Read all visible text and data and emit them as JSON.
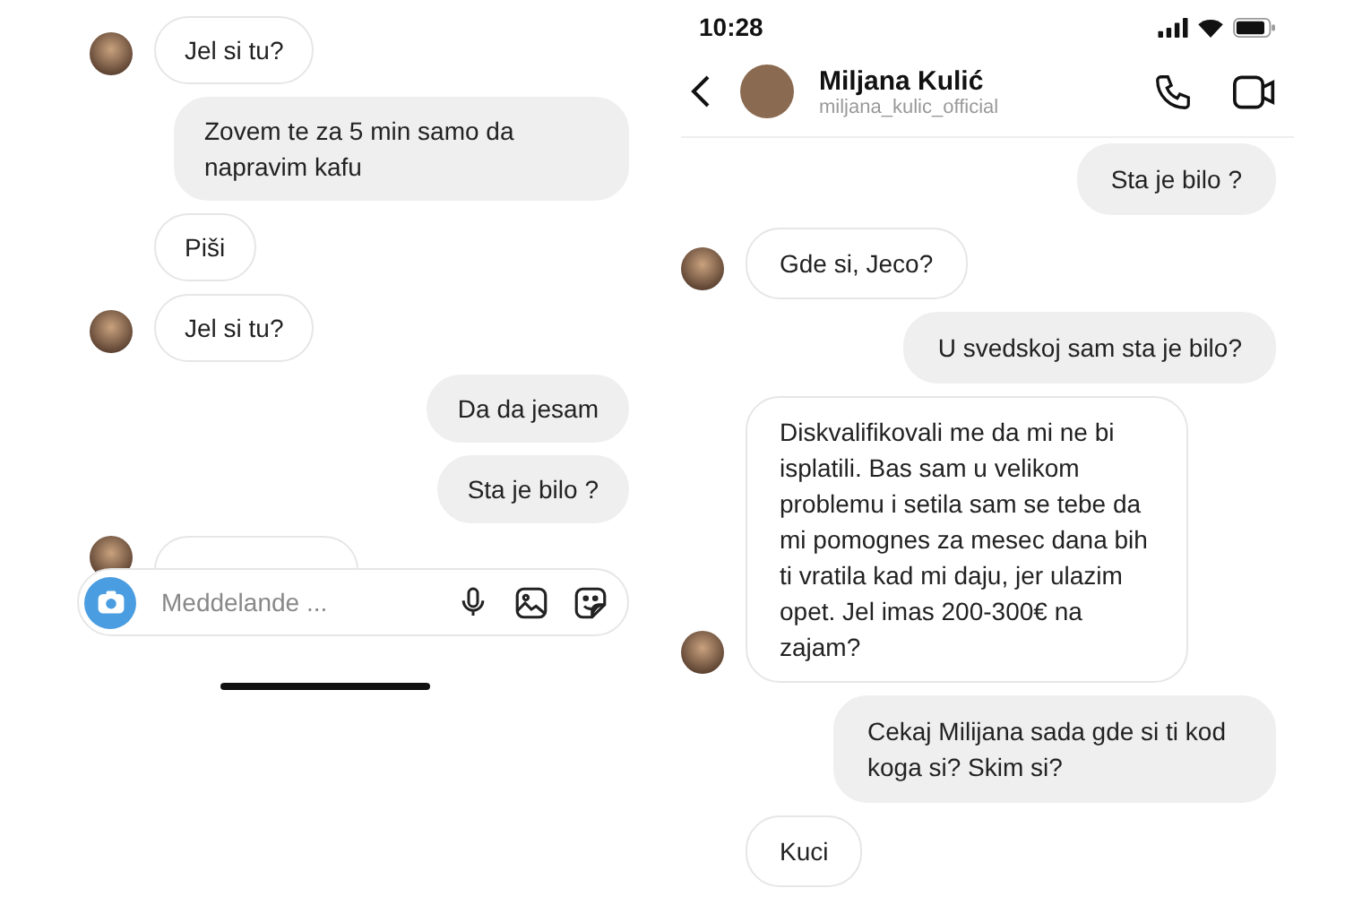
{
  "left_panel": {
    "messages": [
      {
        "kind": "received",
        "text": "Jel si tu?",
        "avatar": true
      },
      {
        "kind": "sent",
        "text": "Zovem te za 5 min samo da napravim kafu"
      },
      {
        "kind": "received",
        "text": "Piši",
        "avatar": false
      },
      {
        "kind": "received",
        "text": "Jel si tu?",
        "avatar": true
      },
      {
        "kind": "sent",
        "text": "Da da jesam"
      },
      {
        "kind": "sent",
        "text": "Sta je bilo ?"
      },
      {
        "kind": "covered",
        "avatar": true
      }
    ],
    "composer": {
      "placeholder": "Meddelande ..."
    }
  },
  "right_panel": {
    "status_bar": {
      "time": "10:28"
    },
    "header": {
      "name": "Miljana Kulić",
      "username": "miljana_kulic_official"
    },
    "messages": [
      {
        "kind": "sent",
        "text": "Sta je bilo ?"
      },
      {
        "kind": "received",
        "text": "Gde si, Jeco?",
        "avatar": true
      },
      {
        "kind": "sent",
        "text": "U svedskoj sam sta je bilo?"
      },
      {
        "kind": "received",
        "text": "Diskvalifikovali me da mi ne bi isplatili. Bas sam u velikom problemu i setila sam se tebe da mi pomognes za mesec dana bih ti vratila kad mi daju, jer ulazim opet. Jel imas 200-300€ na zajam?",
        "avatar": true
      },
      {
        "kind": "sent",
        "text": "Cekaj Milijana sada gde si ti kod koga si? Skim si?"
      },
      {
        "kind": "received",
        "text": "Kuci",
        "avatar": false
      }
    ]
  }
}
